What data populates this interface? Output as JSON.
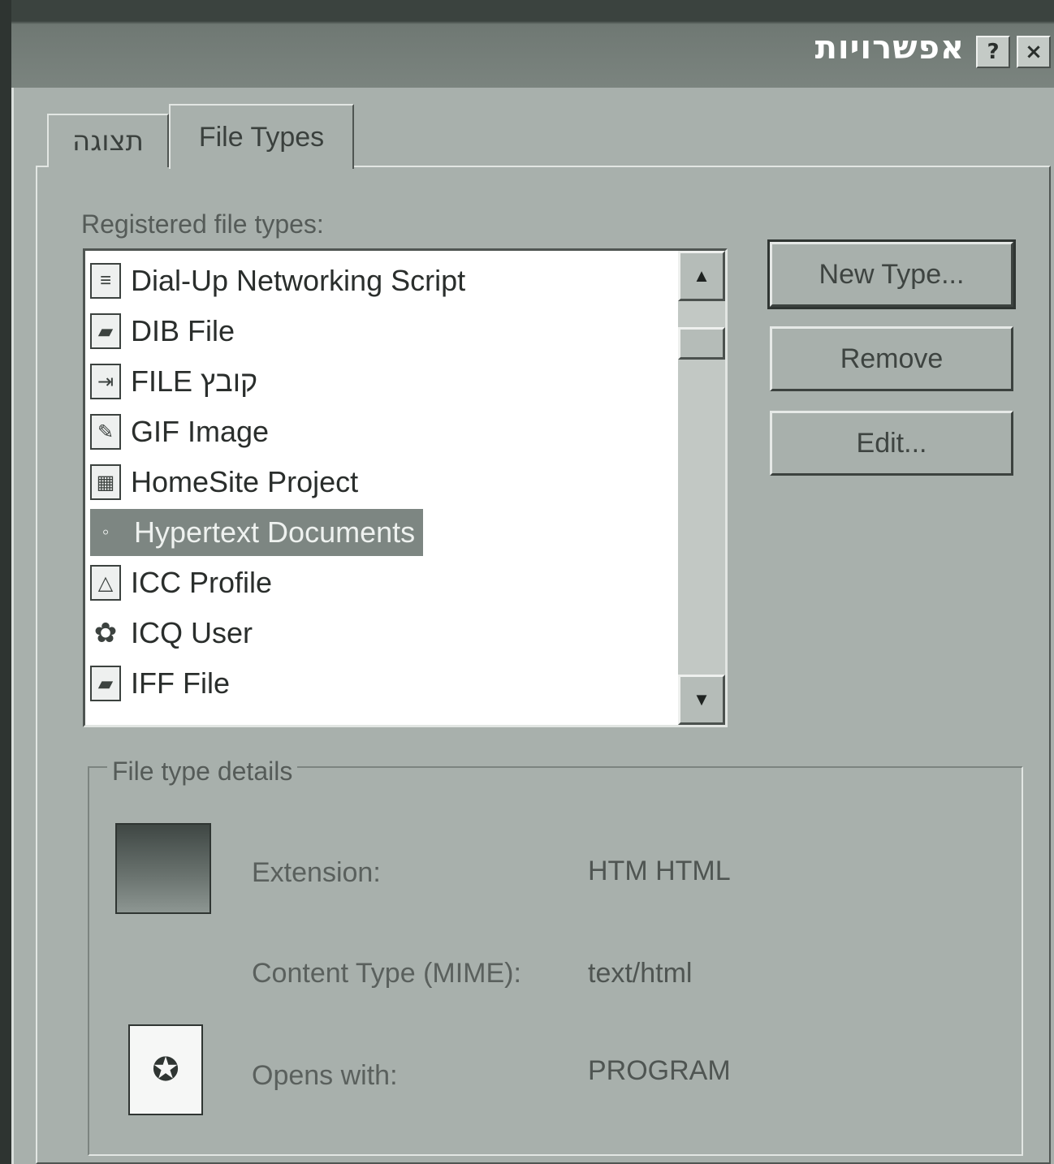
{
  "window": {
    "title": "אפשרויות",
    "help_button": "?",
    "close_button": "×"
  },
  "tabs": [
    {
      "label": "תצוגה"
    },
    {
      "label": "File Types"
    }
  ],
  "registered": {
    "label": "Registered file types:",
    "items": [
      {
        "label": "Dial-Up Networking Script",
        "icon": "script-file-icon"
      },
      {
        "label": "DIB File",
        "icon": "image-file-icon"
      },
      {
        "label": "FILE קובץ",
        "icon": "generic-file-icon"
      },
      {
        "label": "GIF Image",
        "icon": "gif-image-icon"
      },
      {
        "label": "HomeSite Project",
        "icon": "project-file-icon"
      },
      {
        "label": "Hypertext Documents",
        "icon": "html-document-icon",
        "selected": true
      },
      {
        "label": "ICC Profile",
        "icon": "icc-profile-icon"
      },
      {
        "label": "ICQ User",
        "icon": "icq-flower-icon"
      },
      {
        "label": "IFF File",
        "icon": "image-file-icon"
      }
    ]
  },
  "buttons": {
    "new_type": "New Type...",
    "remove": "Remove",
    "edit": "Edit..."
  },
  "details": {
    "group_title": "File type details",
    "extension_label": "Extension:",
    "extension_value": "HTM HTML",
    "content_type_label": "Content Type (MIME):",
    "content_type_value": "text/html",
    "opens_with_label": "Opens with:",
    "opens_with_value": "PROGRAM"
  }
}
